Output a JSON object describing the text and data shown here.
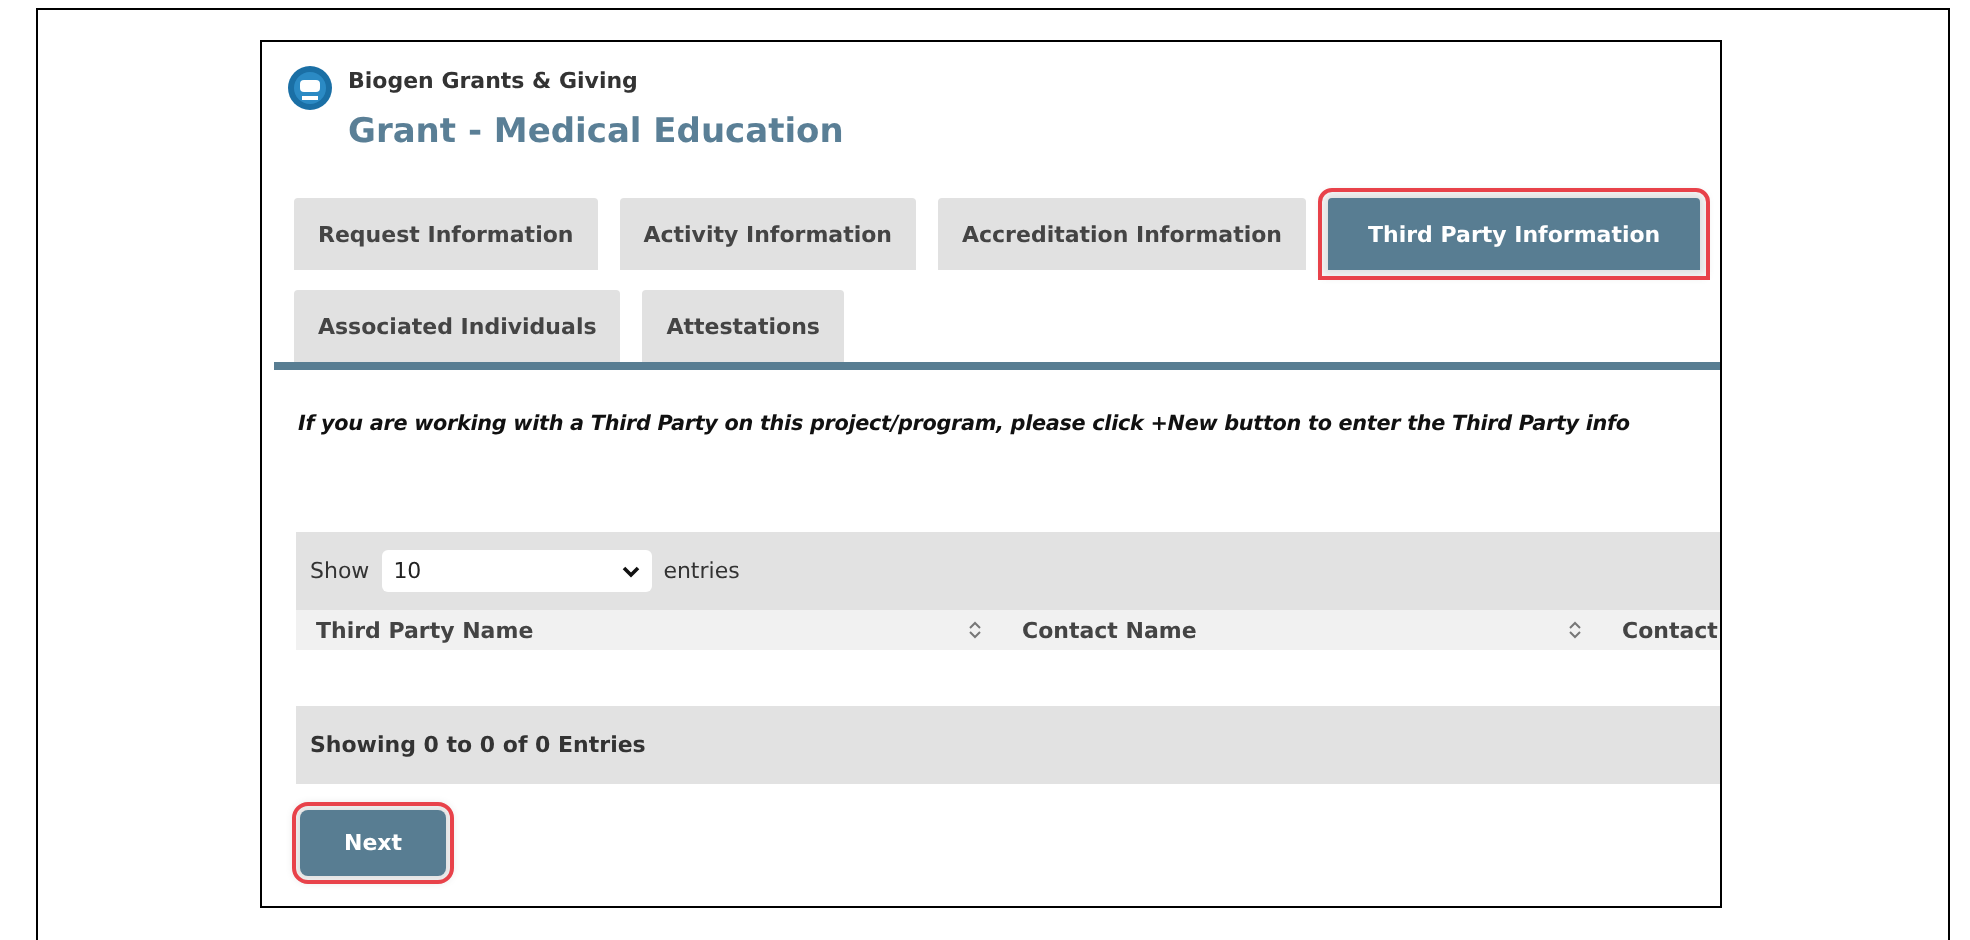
{
  "app": {
    "brand": "Biogen Grants & Giving",
    "title": "Grant - Medical Education"
  },
  "tabs": [
    {
      "label": "Request Information",
      "selected": false,
      "highlighted": false
    },
    {
      "label": "Activity Information",
      "selected": false,
      "highlighted": false
    },
    {
      "label": "Accreditation Information",
      "selected": false,
      "highlighted": false
    },
    {
      "label": "Third Party Information",
      "selected": true,
      "highlighted": true
    },
    {
      "label": "Associated Individuals",
      "selected": false,
      "highlighted": false
    },
    {
      "label": "Attestations",
      "selected": false,
      "highlighted": false
    }
  ],
  "instruction": "If you are working with a Third Party on this project/program, please click +New button to enter the Third Party info",
  "table": {
    "show_label": "Show",
    "page_length": "10",
    "entries_label": "entries",
    "columns": [
      "Third Party Name",
      "Contact Name",
      "Contact"
    ],
    "info": "Showing 0 to 0 of 0 Entries"
  },
  "next_button": {
    "label": "Next",
    "highlighted": true
  }
}
